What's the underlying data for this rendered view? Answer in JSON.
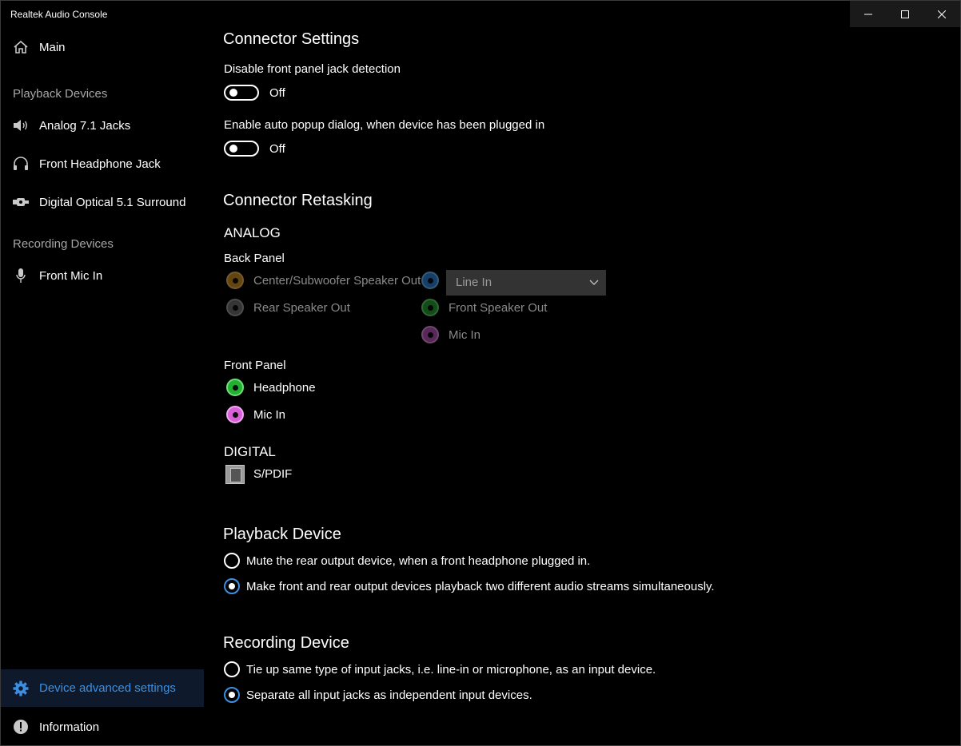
{
  "window": {
    "title": "Realtek Audio Console",
    "controls": {
      "minimize_icon": "minimize-icon",
      "maximize_icon": "maximize-icon",
      "close_icon": "close-icon"
    }
  },
  "sidebar": {
    "main": {
      "label": "Main",
      "icon": "home-icon"
    },
    "playback_header": "Playback Devices",
    "playback_items": [
      {
        "label": "Analog 7.1 Jacks",
        "icon": "speaker-icon"
      },
      {
        "label": "Front Headphone Jack",
        "icon": "headphone-icon"
      },
      {
        "label": "Digital Optical 5.1 Surround",
        "icon": "optical-icon"
      }
    ],
    "recording_header": "Recording Devices",
    "recording_items": [
      {
        "label": "Front Mic In",
        "icon": "microphone-icon"
      }
    ],
    "advanced": {
      "label": "Device advanced settings",
      "icon": "gear-icon",
      "active": true
    },
    "information": {
      "label": "Information",
      "icon": "info-icon"
    }
  },
  "connector_settings": {
    "title": "Connector Settings",
    "disable_jack_detection": {
      "label": "Disable front panel jack detection",
      "state": "Off"
    },
    "auto_popup": {
      "label": "Enable auto popup dialog, when device has been plugged in",
      "state": "Off"
    }
  },
  "connector_retasking": {
    "title": "Connector Retasking",
    "analog_label": "ANALOG",
    "back_panel_label": "Back Panel",
    "back_panel": [
      {
        "label": "Center/Subwoofer Speaker Out",
        "color": "#c7891f"
      },
      {
        "label": "Rear Speaker Out",
        "color": "#8a8a8a"
      },
      {
        "label": "",
        "color": "#3c8fe0",
        "dropdown_value": "Line In"
      },
      {
        "label": "Front Speaker Out",
        "color": "#2fa83a"
      },
      {
        "label": "Mic In",
        "color": "#c05ac0"
      }
    ],
    "front_panel_label": "Front Panel",
    "front_panel": [
      {
        "label": "Headphone",
        "color": "#2fb83a"
      },
      {
        "label": "Mic In",
        "color": "#e070e0"
      }
    ],
    "digital_label": "DIGITAL",
    "digital": [
      {
        "label": "S/PDIF",
        "icon": "spdif-icon"
      }
    ]
  },
  "playback_device": {
    "title": "Playback Device",
    "options": [
      {
        "label": "Mute the rear output device, when a front headphone plugged in.",
        "checked": false
      },
      {
        "label": "Make front and rear output devices playback two different audio streams simultaneously.",
        "checked": true
      }
    ]
  },
  "recording_device": {
    "title": "Recording Device",
    "options": [
      {
        "label": "Tie up same type of input jacks, i.e. line-in or microphone, as an input device.",
        "checked": false
      },
      {
        "label": "Separate all input jacks as independent input devices.",
        "checked": true
      }
    ]
  },
  "colors": {
    "accent": "#3c8fe0",
    "background": "#000000"
  }
}
